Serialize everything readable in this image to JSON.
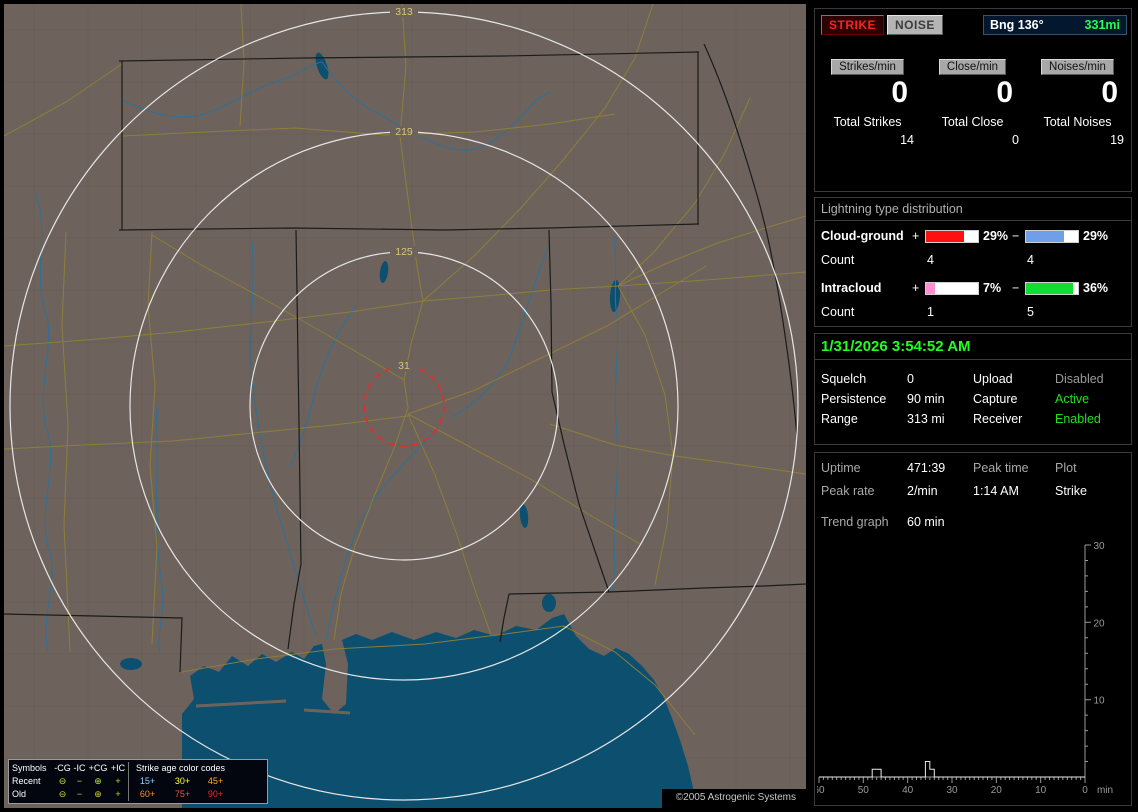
{
  "panel": {
    "buttons": {
      "strike": "STRIKE",
      "noise": "NOISE"
    },
    "bearing": {
      "label": "Bng 136°",
      "value": "331mi"
    },
    "rates": [
      {
        "label": "Strikes/min",
        "value": "0",
        "total_label": "Total Strikes",
        "total_value": "14"
      },
      {
        "label": "Close/min",
        "value": "0",
        "total_label": "Total Close",
        "total_value": "0"
      },
      {
        "label": "Noises/min",
        "value": "0",
        "total_label": "Total Noises",
        "total_value": "19"
      }
    ],
    "distribution": {
      "title": "Lightning type distribution",
      "rows": [
        {
          "name": "Cloud-ground",
          "plus_sign": "+",
          "plus_pct": 29,
          "plus_pct_label": "29%",
          "plus_color": "#ff1010",
          "minus_sign": "−",
          "minus_pct": 29,
          "minus_pct_label": "29%",
          "minus_color": "#6f9fe8",
          "count_label": "Count",
          "plus_count": "4",
          "minus_count": "4"
        },
        {
          "name": "Intracloud",
          "plus_sign": "+",
          "plus_pct": 7,
          "plus_pct_label": "7%",
          "plus_color": "#ff8fd0",
          "minus_sign": "−",
          "minus_pct": 36,
          "minus_pct_label": "36%",
          "minus_color": "#10dd30",
          "count_label": "Count",
          "plus_count": "1",
          "minus_count": "5"
        }
      ]
    },
    "status": {
      "datetime": "1/31/2026 3:54:52 AM",
      "rows": [
        {
          "l1": "Squelch",
          "v1": "0",
          "l2": "Upload",
          "v2": "Disabled",
          "v2_color": "#9a9a9a"
        },
        {
          "l1": "Persistence",
          "v1": "90 min",
          "l2": "Capture",
          "v2": "Active",
          "v2_color": "#20e020"
        },
        {
          "l1": "Range",
          "v1": "313 mi",
          "l2": "Receiver",
          "v2": "Enabled",
          "v2_color": "#20e020"
        }
      ]
    },
    "info": {
      "r1": {
        "l1": "Uptime",
        "v1": "471:39",
        "l2": "Peak time",
        "l3": "Plot"
      },
      "r2": {
        "l1": "Peak rate",
        "v1": "2/min",
        "v2": "1:14 AM",
        "v3": "Strike"
      },
      "trend_label": "Trend graph",
      "trend_value": "60 min"
    }
  },
  "map": {
    "ring_labels": [
      "313",
      "219",
      "125",
      "31"
    ],
    "copyright": "©2005 Astrogenic Systems",
    "legend": {
      "symbols_header": "Symbols",
      "sym_cols": [
        "-CG",
        "-IC",
        "+CG",
        "+IC"
      ],
      "age_header": "Strike age color codes",
      "rows": [
        {
          "label": "Recent",
          "syms": [
            "⊖",
            "−",
            "⊕",
            "+"
          ],
          "sym_color": "#b8e838",
          "ages": [
            "15+",
            "30+",
            "45+"
          ],
          "age_colors": [
            "#8fd0ff",
            "#ffff40",
            "#ffb020"
          ]
        },
        {
          "label": "Old",
          "syms": [
            "⊖",
            "−",
            "⊕",
            "+"
          ],
          "sym_color": "#cfcf30",
          "ages": [
            "60+",
            "75+",
            "90+"
          ],
          "age_colors": [
            "#ff9020",
            "#ff5020",
            "#ff2020"
          ]
        }
      ]
    }
  },
  "chart_data": {
    "type": "bar",
    "title": "Trend graph",
    "window_label": "60 min",
    "xlabel": "min",
    "x_unit": "minutes ago",
    "x_ticks": [
      60,
      50,
      40,
      30,
      20,
      10,
      0
    ],
    "y_ticks": [
      10,
      20,
      30
    ],
    "ylim": [
      0,
      30
    ],
    "series": [
      {
        "name": "Strikes per minute",
        "points": [
          {
            "minutes_ago": 48,
            "value": 1
          },
          {
            "minutes_ago": 47,
            "value": 1
          },
          {
            "minutes_ago": 36,
            "value": 2
          },
          {
            "minutes_ago": 35,
            "value": 1
          }
        ]
      }
    ]
  }
}
